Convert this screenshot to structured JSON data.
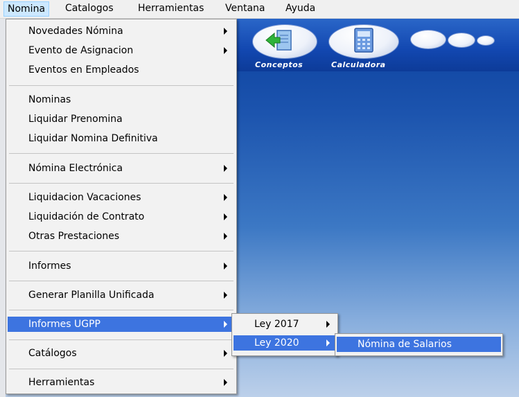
{
  "menubar": {
    "items": [
      "Nomina",
      "Catalogos",
      "Herramientas",
      "Ventana",
      "Ayuda"
    ]
  },
  "toolbar": {
    "buttons": [
      {
        "label": "Conceptos",
        "icon": "green-arrow-document-icon"
      },
      {
        "label": "Calculadora",
        "icon": "calculator-icon"
      }
    ]
  },
  "nomina_menu": {
    "groups": [
      [
        "Novedades Nómina",
        "Evento de Asignacion",
        "Eventos en Empleados"
      ],
      [
        "Nominas",
        "Liquidar Prenomina",
        "Liquidar Nomina Definitiva"
      ],
      [
        "Nómina Electrónica"
      ],
      [
        "Liquidacion Vacaciones",
        "Liquidación de Contrato",
        "Otras Prestaciones"
      ],
      [
        "Informes"
      ],
      [
        "Generar Planilla Unificada"
      ],
      [
        "Informes UGPP"
      ],
      [
        "Catálogos"
      ],
      [
        "Herramientas"
      ]
    ]
  },
  "ugpp_submenu": {
    "items": [
      "Ley 2017",
      "Ley 2020"
    ]
  },
  "ley2020_submenu": {
    "items": [
      "Nómina de Salarios"
    ]
  },
  "colors": {
    "highlight": "#3d74e0",
    "desktop_top": "#0a3f9e",
    "desktop_bottom": "#bcd0ea"
  }
}
